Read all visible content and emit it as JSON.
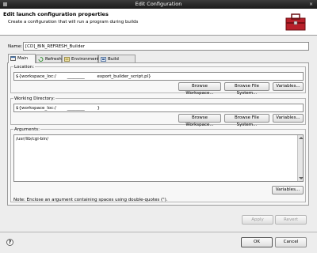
{
  "window": {
    "title": "Edit Configuration",
    "close_glyph": "×"
  },
  "header": {
    "title": "Edit launch configuration properties",
    "description": "Create a configuration that will run a program during builds",
    "icon": "toolbox-icon"
  },
  "name": {
    "label": "Name:",
    "value": "[CD]_BIN_REFRESH_Builder"
  },
  "tabs": [
    {
      "label": "Main",
      "icon": "main-icon",
      "active": true
    },
    {
      "label": "Refresh",
      "icon": "refresh-icon",
      "active": false
    },
    {
      "label": "Environment",
      "icon": "environment-icon",
      "active": false
    },
    {
      "label": "Build Options",
      "icon": "build-options-icon",
      "active": false
    }
  ],
  "location": {
    "label": "Location:",
    "value": "${workspace_loc:/        ________         export_builder_script.pl}",
    "browse_workspace": "Browse Workspace...",
    "browse_file_system": "Browse File System...",
    "variables": "Variables..."
  },
  "working_directory": {
    "label": "Working Directory:",
    "value": "${workspace_loc:/        ________         }",
    "browse_workspace": "Browse Workspace...",
    "browse_file_system": "Browse File System...",
    "variables": "Variables..."
  },
  "arguments": {
    "label": "Arguments:",
    "value": "/usr/lib/cgi-bin/",
    "variables": "Variables...",
    "note": "Note: Enclose an argument containing spaces using double-quotes (\")."
  },
  "actions": {
    "apply": "Apply",
    "revert": "Revert",
    "ok": "OK",
    "cancel": "Cancel",
    "help": "?"
  }
}
